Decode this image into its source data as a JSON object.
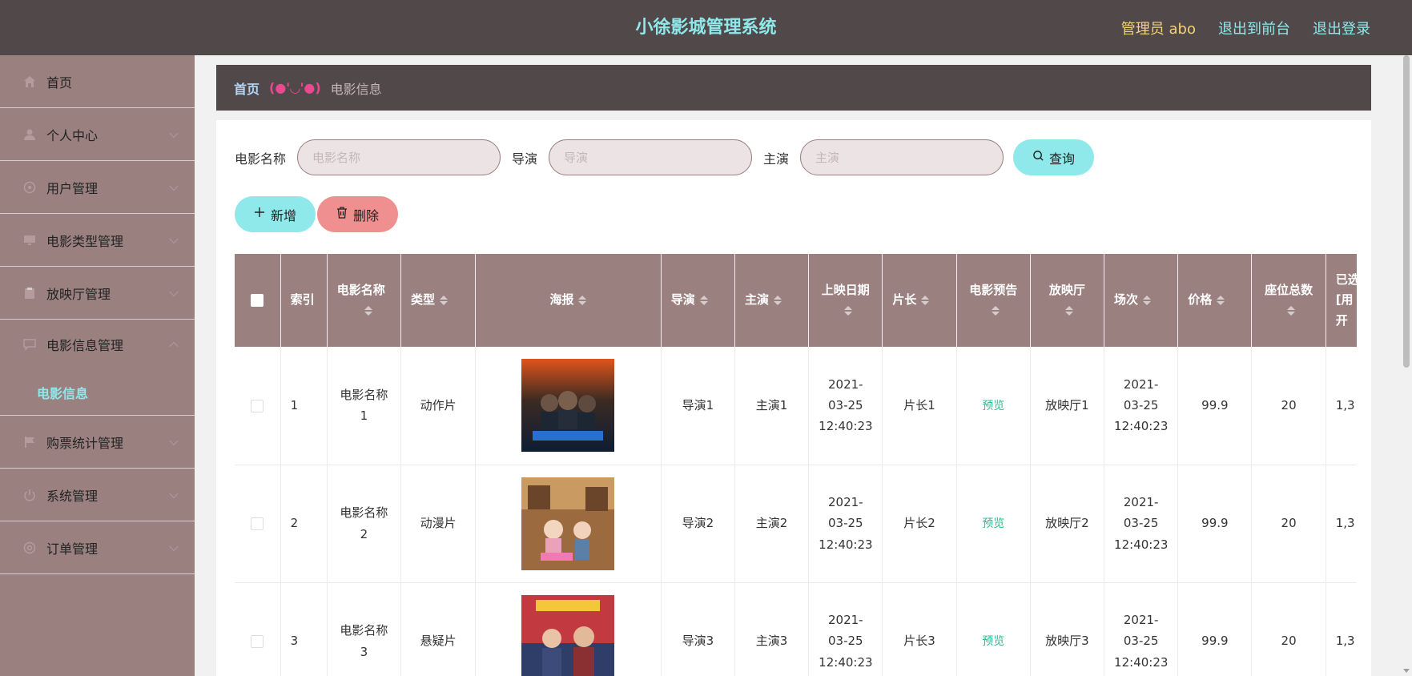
{
  "header": {
    "title": "小徐影城管理系统",
    "admin": "管理员 abo",
    "back_to_front": "退出到前台",
    "logout": "退出登录"
  },
  "sidebar": {
    "items": [
      {
        "label": "首页",
        "icon": "home-icon"
      },
      {
        "label": "个人中心",
        "icon": "user-icon"
      },
      {
        "label": "用户管理",
        "icon": "users-icon"
      },
      {
        "label": "电影类型管理",
        "icon": "monitor-icon"
      },
      {
        "label": "放映厅管理",
        "icon": "clipboard-icon"
      },
      {
        "label": "电影信息管理",
        "icon": "chat-icon"
      },
      {
        "label": "购票统计管理",
        "icon": "flag-icon"
      },
      {
        "label": "系统管理",
        "icon": "power-icon"
      },
      {
        "label": "订单管理",
        "icon": "gear-icon"
      }
    ],
    "sub_item": "电影信息"
  },
  "breadcrumb": {
    "home": "首页",
    "separator": "(●'◡'●)",
    "current": "电影信息"
  },
  "search": {
    "name_label": "电影名称",
    "name_placeholder": "电影名称",
    "director_label": "导演",
    "director_placeholder": "导演",
    "actor_label": "主演",
    "actor_placeholder": "主演",
    "query_button": "查询"
  },
  "actions": {
    "add": "新增",
    "delete": "删除"
  },
  "table": {
    "headers": {
      "index": "索引",
      "name": "电影名称",
      "type": "类型",
      "poster": "海报",
      "director": "导演",
      "actor": "主演",
      "release": "上映日期",
      "duration": "片长",
      "trailer": "电影预告",
      "hall": "放映厅",
      "session": "场次",
      "price": "价格",
      "seats": "座位总数",
      "sold": "已选[用开"
    },
    "rows": [
      {
        "index": "1",
        "name": "电影名称1",
        "type": "动作片",
        "director": "导演1",
        "actor": "主演1",
        "release": "2021-03-25 12:40:23",
        "duration": "片长1",
        "trailer": "预览",
        "hall": "放映厅1",
        "session": "2021-03-25 12:40:23",
        "price": "99.9",
        "seats": "20",
        "sold": "1,3"
      },
      {
        "index": "2",
        "name": "电影名称2",
        "type": "动漫片",
        "director": "导演2",
        "actor": "主演2",
        "release": "2021-03-25 12:40:23",
        "duration": "片长2",
        "trailer": "预览",
        "hall": "放映厅2",
        "session": "2021-03-25 12:40:23",
        "price": "99.9",
        "seats": "20",
        "sold": "1,3"
      },
      {
        "index": "3",
        "name": "电影名称3",
        "type": "悬疑片",
        "director": "导演3",
        "actor": "主演3",
        "release": "2021-03-25 12:40:23",
        "duration": "片长3",
        "trailer": "预览",
        "hall": "放映厅3",
        "session": "2021-03-25 12:40:23",
        "price": "99.9",
        "seats": "20",
        "sold": "1,3"
      }
    ]
  },
  "colors": {
    "header_bg": "#514849",
    "sidebar_bg": "#9b8080",
    "accent_cyan": "#8fe9ea",
    "accent_gold": "#f3d37c",
    "delete_red": "#f08f8f",
    "preview_green": "#2bbd8f"
  }
}
